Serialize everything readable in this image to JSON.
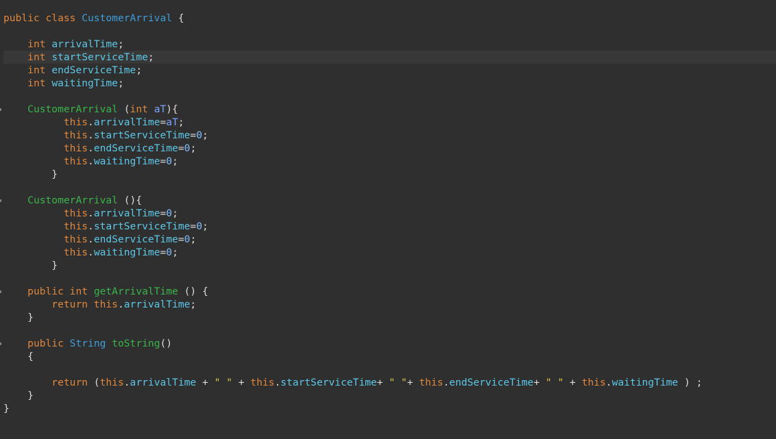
{
  "editor": {
    "lines": [
      [
        {
          "t": "public class ",
          "c": "kw"
        },
        {
          "t": "CustomerArrival",
          "c": "ty"
        },
        {
          "t": " {",
          "c": "pl"
        }
      ],
      [],
      [
        {
          "t": "    ",
          "c": "pl"
        },
        {
          "t": "int",
          "c": "kw"
        },
        {
          "t": " ",
          "c": "pl"
        },
        {
          "t": "arrivalTime",
          "c": "fld"
        },
        {
          "t": ";",
          "c": "pl"
        }
      ],
      [
        {
          "t": "    ",
          "c": "pl"
        },
        {
          "t": "int",
          "c": "kw"
        },
        {
          "t": " ",
          "c": "pl"
        },
        {
          "t": "startServiceTime",
          "c": "fld"
        },
        {
          "t": ";",
          "c": "pl"
        }
      ],
      [
        {
          "t": "    ",
          "c": "pl"
        },
        {
          "t": "int",
          "c": "kw"
        },
        {
          "t": " ",
          "c": "pl"
        },
        {
          "t": "endServiceTime",
          "c": "fld"
        },
        {
          "t": ";",
          "c": "pl"
        }
      ],
      [
        {
          "t": "    ",
          "c": "pl"
        },
        {
          "t": "int",
          "c": "kw"
        },
        {
          "t": " ",
          "c": "pl"
        },
        {
          "t": "waitingTime",
          "c": "fld"
        },
        {
          "t": ";",
          "c": "pl"
        }
      ],
      [],
      [
        {
          "t": "    ",
          "c": "pl"
        },
        {
          "t": "CustomerArrival",
          "c": "ctor"
        },
        {
          "t": " (",
          "c": "pl"
        },
        {
          "t": "int",
          "c": "kw"
        },
        {
          "t": " ",
          "c": "pl"
        },
        {
          "t": "aT",
          "c": "prm"
        },
        {
          "t": "){",
          "c": "pl"
        }
      ],
      [
        {
          "t": "          ",
          "c": "pl"
        },
        {
          "t": "this",
          "c": "kw"
        },
        {
          "t": ".",
          "c": "pl"
        },
        {
          "t": "arrivalTime",
          "c": "fld"
        },
        {
          "t": "=",
          "c": "pl"
        },
        {
          "t": "aT",
          "c": "prm"
        },
        {
          "t": ";",
          "c": "pl"
        }
      ],
      [
        {
          "t": "          ",
          "c": "pl"
        },
        {
          "t": "this",
          "c": "kw"
        },
        {
          "t": ".",
          "c": "pl"
        },
        {
          "t": "startServiceTime",
          "c": "fld"
        },
        {
          "t": "=",
          "c": "pl"
        },
        {
          "t": "0",
          "c": "num"
        },
        {
          "t": ";",
          "c": "pl"
        }
      ],
      [
        {
          "t": "          ",
          "c": "pl"
        },
        {
          "t": "this",
          "c": "kw"
        },
        {
          "t": ".",
          "c": "pl"
        },
        {
          "t": "endServiceTime",
          "c": "fld"
        },
        {
          "t": "=",
          "c": "pl"
        },
        {
          "t": "0",
          "c": "num"
        },
        {
          "t": ";",
          "c": "pl"
        }
      ],
      [
        {
          "t": "          ",
          "c": "pl"
        },
        {
          "t": "this",
          "c": "kw"
        },
        {
          "t": ".",
          "c": "pl"
        },
        {
          "t": "waitingTime",
          "c": "fld"
        },
        {
          "t": "=",
          "c": "pl"
        },
        {
          "t": "0",
          "c": "num"
        },
        {
          "t": ";",
          "c": "pl"
        }
      ],
      [
        {
          "t": "        }",
          "c": "pl"
        }
      ],
      [],
      [
        {
          "t": "    ",
          "c": "pl"
        },
        {
          "t": "CustomerArrival",
          "c": "ctor"
        },
        {
          "t": " (){",
          "c": "pl"
        }
      ],
      [
        {
          "t": "          ",
          "c": "pl"
        },
        {
          "t": "this",
          "c": "kw"
        },
        {
          "t": ".",
          "c": "pl"
        },
        {
          "t": "arrivalTime",
          "c": "fld"
        },
        {
          "t": "=",
          "c": "pl"
        },
        {
          "t": "0",
          "c": "num"
        },
        {
          "t": ";",
          "c": "pl"
        }
      ],
      [
        {
          "t": "          ",
          "c": "pl"
        },
        {
          "t": "this",
          "c": "kw"
        },
        {
          "t": ".",
          "c": "pl"
        },
        {
          "t": "startServiceTime",
          "c": "fld"
        },
        {
          "t": "=",
          "c": "pl"
        },
        {
          "t": "0",
          "c": "num"
        },
        {
          "t": ";",
          "c": "pl"
        }
      ],
      [
        {
          "t": "          ",
          "c": "pl"
        },
        {
          "t": "this",
          "c": "kw"
        },
        {
          "t": ".",
          "c": "pl"
        },
        {
          "t": "endServiceTime",
          "c": "fld"
        },
        {
          "t": "=",
          "c": "pl"
        },
        {
          "t": "0",
          "c": "num"
        },
        {
          "t": ";",
          "c": "pl"
        }
      ],
      [
        {
          "t": "          ",
          "c": "pl"
        },
        {
          "t": "this",
          "c": "kw"
        },
        {
          "t": ".",
          "c": "pl"
        },
        {
          "t": "waitingTime",
          "c": "fld"
        },
        {
          "t": "=",
          "c": "pl"
        },
        {
          "t": "0",
          "c": "num"
        },
        {
          "t": ";",
          "c": "pl"
        }
      ],
      [
        {
          "t": "        }",
          "c": "pl"
        }
      ],
      [],
      [
        {
          "t": "    ",
          "c": "pl"
        },
        {
          "t": "public int ",
          "c": "kw"
        },
        {
          "t": "getArrivalTime",
          "c": "ctor"
        },
        {
          "t": " () {",
          "c": "pl"
        }
      ],
      [
        {
          "t": "        ",
          "c": "pl"
        },
        {
          "t": "return this",
          "c": "kw"
        },
        {
          "t": ".",
          "c": "pl"
        },
        {
          "t": "arrivalTime",
          "c": "fld"
        },
        {
          "t": ";",
          "c": "pl"
        }
      ],
      [
        {
          "t": "    }",
          "c": "pl"
        }
      ],
      [],
      [
        {
          "t": "    ",
          "c": "pl"
        },
        {
          "t": "public ",
          "c": "kw"
        },
        {
          "t": "String",
          "c": "ty"
        },
        {
          "t": " ",
          "c": "pl"
        },
        {
          "t": "toString",
          "c": "ctor"
        },
        {
          "t": "()",
          "c": "pl"
        }
      ],
      [
        {
          "t": "    {",
          "c": "pl"
        }
      ],
      [],
      [
        {
          "t": "        ",
          "c": "pl"
        },
        {
          "t": "return",
          "c": "kw"
        },
        {
          "t": " (",
          "c": "pl"
        },
        {
          "t": "this",
          "c": "kw"
        },
        {
          "t": ".",
          "c": "pl"
        },
        {
          "t": "arrivalTime",
          "c": "fld"
        },
        {
          "t": " + ",
          "c": "pl"
        },
        {
          "t": "\" \"",
          "c": "str"
        },
        {
          "t": " + ",
          "c": "pl"
        },
        {
          "t": "this",
          "c": "kw"
        },
        {
          "t": ".",
          "c": "pl"
        },
        {
          "t": "startServiceTime",
          "c": "fld"
        },
        {
          "t": "+ ",
          "c": "pl"
        },
        {
          "t": "\" \"",
          "c": "str"
        },
        {
          "t": "+ ",
          "c": "pl"
        },
        {
          "t": "this",
          "c": "kw"
        },
        {
          "t": ".",
          "c": "pl"
        },
        {
          "t": "endServiceTime",
          "c": "fld"
        },
        {
          "t": "+ ",
          "c": "pl"
        },
        {
          "t": "\" \"",
          "c": "str"
        },
        {
          "t": " + ",
          "c": "pl"
        },
        {
          "t": "this",
          "c": "kw"
        },
        {
          "t": ".",
          "c": "pl"
        },
        {
          "t": "waitingTime",
          "c": "fld"
        },
        {
          "t": " ) ;",
          "c": "pl"
        }
      ],
      [
        {
          "t": "    }",
          "c": "pl"
        }
      ],
      [
        {
          "t": "}",
          "c": "pl"
        }
      ]
    ],
    "fold_marker_lines": [
      7,
      14,
      21,
      25
    ],
    "current_line": 3
  }
}
